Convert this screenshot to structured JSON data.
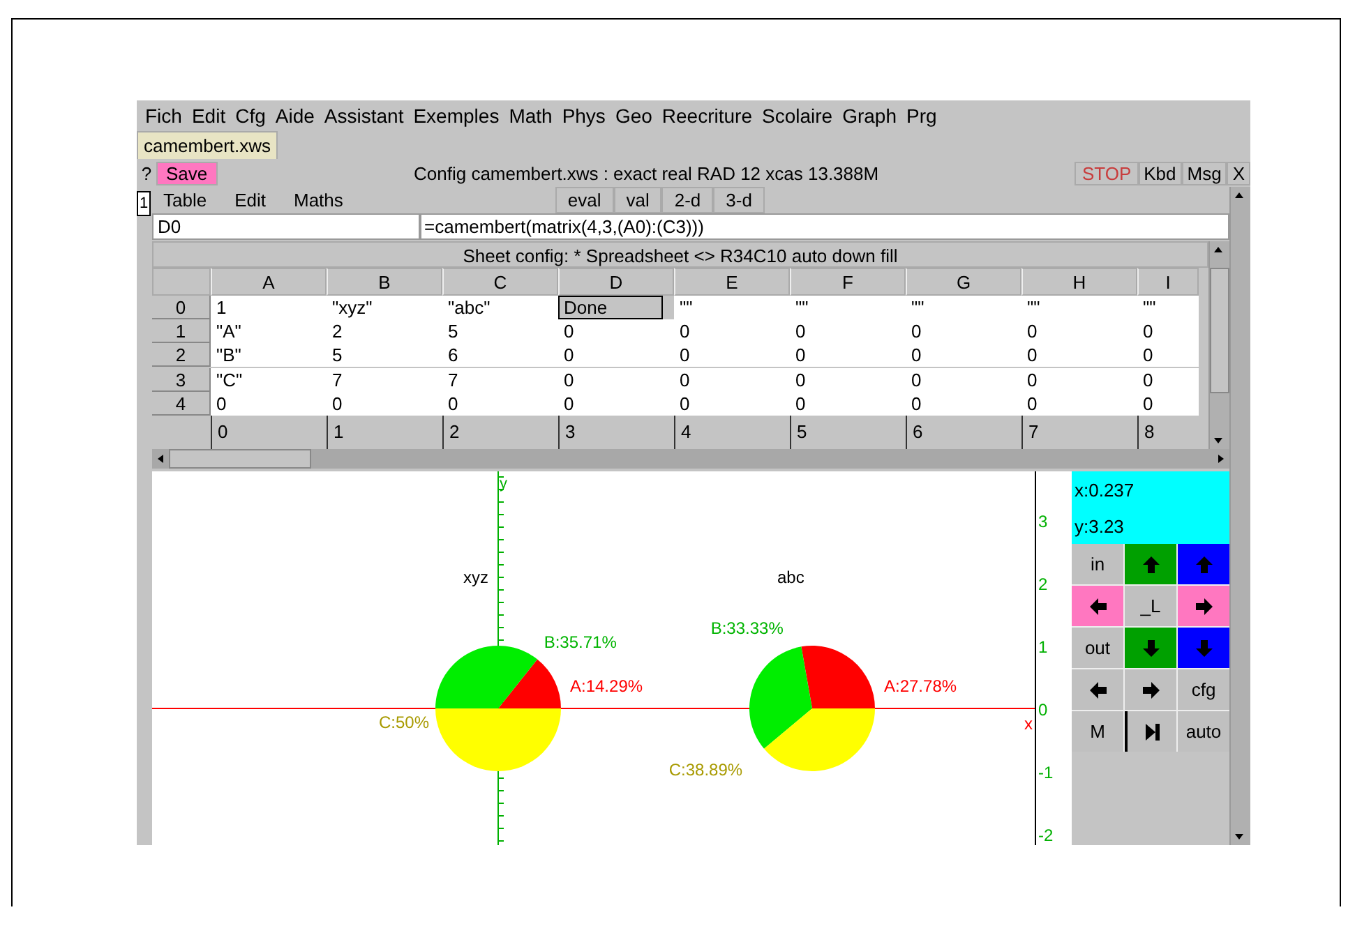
{
  "menu": [
    "Fich",
    "Edit",
    "Cfg",
    "Aide",
    "Assistant",
    "Exemples",
    "Math",
    "Phys",
    "Geo",
    "Reecriture",
    "Scolaire",
    "Graph",
    "Prg"
  ],
  "tabs": [
    {
      "label": "camembert.xws",
      "selected": true
    }
  ],
  "toolbar": {
    "help": "?",
    "save": "Save",
    "status": "Config camembert.xws : exact real RAD 12 xcas 13.388M",
    "stop": {
      "label": "STOP",
      "disabled": true
    },
    "buttons": [
      "Kbd",
      "Msg",
      "X"
    ]
  },
  "level_number": "1",
  "sheet_menu": [
    "Table",
    "Edit",
    "Maths"
  ],
  "sheet_buttons": [
    "eval",
    "val",
    "2-d",
    "3-d"
  ],
  "cell_ref": "D0",
  "formula": "=camembert(matrix(4,3,(A0):(C3)))",
  "sheet_config": "Sheet config: * Spreadsheet <> R34C10 auto down fill",
  "columns": [
    "A",
    "B",
    "C",
    "D",
    "E",
    "F",
    "G",
    "H",
    "I"
  ],
  "rows": [
    {
      "header": "0",
      "cells": [
        {
          "v": "1",
          "selected": false
        },
        {
          "v": "\"xyz\"",
          "selected": false
        },
        {
          "v": "\"abc\"",
          "selected": false
        },
        {
          "v": "Done",
          "selected": true
        },
        {
          "v": "\"\"",
          "selected": false
        },
        {
          "v": "\"\"",
          "selected": false
        },
        {
          "v": "\"\"",
          "selected": false
        },
        {
          "v": "\"\"",
          "selected": false
        },
        {
          "v": "\"\"",
          "selected": false
        }
      ]
    },
    {
      "header": "1",
      "cells": [
        {
          "v": "\"A\"",
          "selected": false
        },
        {
          "v": "2",
          "selected": false
        },
        {
          "v": "5",
          "selected": false
        },
        {
          "v": "0",
          "selected": false
        },
        {
          "v": "0",
          "selected": false
        },
        {
          "v": "0",
          "selected": false
        },
        {
          "v": "0",
          "selected": false
        },
        {
          "v": "0",
          "selected": false
        },
        {
          "v": "0",
          "selected": false
        }
      ]
    },
    {
      "header": "2",
      "cells": [
        {
          "v": "\"B\"",
          "selected": false
        },
        {
          "v": "5",
          "selected": false
        },
        {
          "v": "6",
          "selected": false
        },
        {
          "v": "0",
          "selected": false
        },
        {
          "v": "0",
          "selected": false
        },
        {
          "v": "0",
          "selected": false
        },
        {
          "v": "0",
          "selected": false
        },
        {
          "v": "0",
          "selected": false
        },
        {
          "v": "0",
          "selected": false
        }
      ]
    },
    {
      "header": "3",
      "cells": [
        {
          "v": "\"C\"",
          "selected": false
        },
        {
          "v": "7",
          "selected": false
        },
        {
          "v": "7",
          "selected": false
        },
        {
          "v": "0",
          "selected": false
        },
        {
          "v": "0",
          "selected": false
        },
        {
          "v": "0",
          "selected": false
        },
        {
          "v": "0",
          "selected": false
        },
        {
          "v": "0",
          "selected": false
        },
        {
          "v": "0",
          "selected": false
        }
      ]
    },
    {
      "header": "4",
      "cells": [
        {
          "v": "0",
          "selected": false
        },
        {
          "v": "0",
          "selected": false
        },
        {
          "v": "0",
          "selected": false
        },
        {
          "v": "0",
          "selected": false
        },
        {
          "v": "0",
          "selected": false
        },
        {
          "v": "0",
          "selected": false
        },
        {
          "v": "0",
          "selected": false
        },
        {
          "v": "0",
          "selected": false
        },
        {
          "v": "0",
          "selected": false
        }
      ]
    }
  ],
  "footer": [
    "0",
    "1",
    "2",
    "3",
    "4",
    "5",
    "6",
    "7",
    "8"
  ],
  "graph": {
    "x_label": "x",
    "y_label": "y",
    "y_ticks": [
      "3",
      "2",
      "1",
      "0",
      "-1",
      "-2"
    ],
    "pies": [
      {
        "chart_data": {
          "type": "pie",
          "title": "xyz",
          "values": [
            14.29,
            35.71,
            50
          ],
          "value_labels": [
            "A:14.29%",
            "B:35.71%",
            "C:50%"
          ]
        }
      },
      {
        "chart_data": {
          "type": "pie",
          "title": "abc",
          "values": [
            27.78,
            33.33,
            38.89
          ],
          "value_labels": [
            "A:27.78%",
            "B:33.33%",
            "C:38.89%"
          ]
        }
      }
    ]
  },
  "coords": [
    "x:0.237",
    "y:3.23"
  ],
  "controls": [
    {
      "kind": "text",
      "label": "in",
      "color": "#c0c0c0"
    },
    {
      "kind": "up",
      "color": "#00a000"
    },
    {
      "kind": "up",
      "color": "#0000ff"
    },
    {
      "kind": "left",
      "color": "#ff77c0"
    },
    {
      "kind": "text",
      "label": "_L",
      "color": "#c0c0c0"
    },
    {
      "kind": "right",
      "color": "#ff77c0"
    },
    {
      "kind": "text",
      "label": "out",
      "color": "#c0c0c0"
    },
    {
      "kind": "down",
      "color": "#00a000"
    },
    {
      "kind": "down",
      "color": "#0000ff"
    },
    {
      "kind": "left",
      "color": "#c0c0c0"
    },
    {
      "kind": "right",
      "color": "#c0c0c0"
    },
    {
      "kind": "text",
      "label": "cfg",
      "color": "#c0c0c0"
    },
    {
      "kind": "text",
      "label": "M",
      "color": "#c0c0c0"
    },
    {
      "kind": "step",
      "color": "#c0c0c0"
    },
    {
      "kind": "text",
      "label": "auto",
      "color": "#c0c0c0"
    }
  ]
}
